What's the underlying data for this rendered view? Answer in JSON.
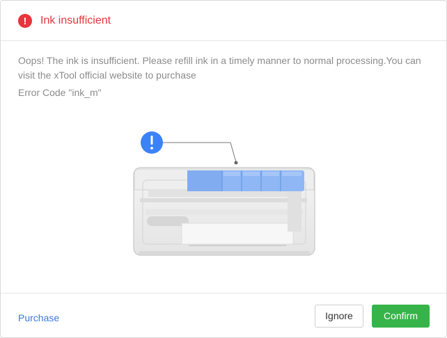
{
  "dialog": {
    "title": "Ink insufficient",
    "title_icon": "exclamation-circle-icon",
    "message": "Oops! The ink is insufficient. Please refill ink in a timely manner to normal processing.You can visit the xTool official website to purchase",
    "error_code": "Error Code \"ink_m\"",
    "illustration_icon": "info-exclamation-icon"
  },
  "footer": {
    "purchase_label": "Purchase",
    "ignore_label": "Ignore",
    "confirm_label": "Confirm"
  },
  "colors": {
    "error": "#e8343b",
    "link": "#3a7be0",
    "confirm": "#36b44a",
    "ink_cartridge": "#8fb7f5"
  }
}
